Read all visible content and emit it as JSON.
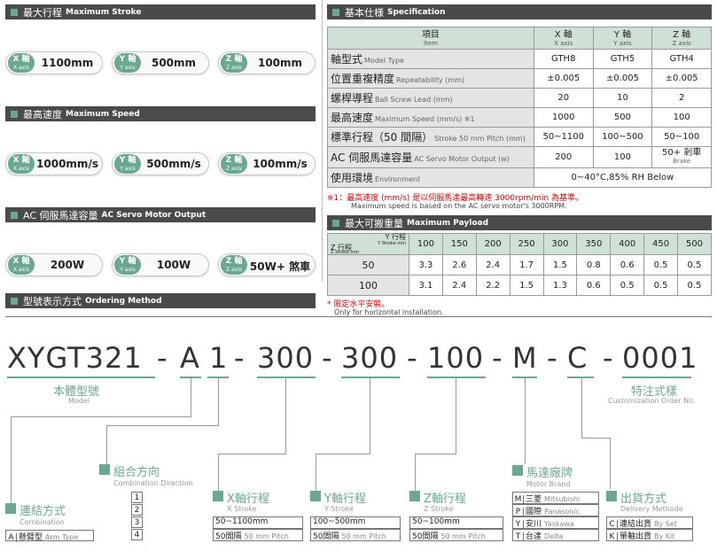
{
  "sections": {
    "stroke": {
      "zh": "最大行程",
      "en": "Maximum Stroke"
    },
    "speed": {
      "zh": "最高速度",
      "en": "Maximum Speed"
    },
    "motor": {
      "zh": "AC 伺服馬達容量",
      "en": "AC Servo Motor Output"
    },
    "spec": {
      "zh": "基本仕様",
      "en": "Specification"
    },
    "payload": {
      "zh": "最大可搬重量",
      "en": "Maximum Payload"
    },
    "ordering": {
      "zh": "型號表示方式",
      "en": "Ordering Method"
    }
  },
  "axis_labels": {
    "x": {
      "zh": "X 軸",
      "en": "X axis"
    },
    "y": {
      "zh": "Y 軸",
      "en": "Y axis"
    },
    "z": {
      "zh": "Z 軸",
      "en": "Z axis"
    }
  },
  "stroke_values": {
    "x": "1100mm",
    "y": "500mm",
    "z": "100mm"
  },
  "speed_values": {
    "x": "1000mm/s",
    "y": "500mm/s",
    "z": "100mm/s"
  },
  "motor_values": {
    "x": "200W",
    "y": "100W",
    "z": "50W+ 煞車"
  },
  "spec_table": {
    "header": {
      "item_zh": "項目",
      "item_en": "Item",
      "x_zh": "X 軸",
      "x_en": "X axis",
      "y_zh": "Y 軸",
      "y_en": "Y axis",
      "z_zh": "Z 軸",
      "z_en": "Z axis"
    },
    "rows": [
      {
        "zh": "軸型式",
        "en": "Model Type",
        "x": "GTH8",
        "y": "GTH5",
        "z": "GTH4"
      },
      {
        "zh": "位置重複精度",
        "en": "Repeatability (mm)",
        "x": "±0.005",
        "y": "±0.005",
        "z": "±0.005"
      },
      {
        "zh": "螺桿導程",
        "en": "Ball Screw Lead (mm)",
        "x": "20",
        "y": "10",
        "z": "2"
      },
      {
        "zh": "最高速度",
        "en": "Maximum Speed (mm/s) ※1",
        "x": "1000",
        "y": "500",
        "z": "100"
      },
      {
        "zh": "標準行程（50 間隔）",
        "en": "Stroke 50 mm Pitch (mm)",
        "x": "50~1100",
        "y": "100~500",
        "z": "50~100"
      },
      {
        "zh": "AC 伺服馬達容量",
        "en": "AC Servo Motor Output (w)",
        "x": "200",
        "y": "100",
        "z": "50+ 剎車",
        "z_sub": "Brake"
      },
      {
        "zh": "使用環境",
        "en": "Environment",
        "env": "0~40°C,85% RH Below"
      }
    ],
    "note_zh": "※1：最高速度 (mm/s) 是以伺服馬達最高轉速 3000rpm/min 為基準。",
    "note_en": "Maximum speed is based on the AC servo motor's 3000RPM."
  },
  "payload_table": {
    "corner_z": "Z 行程",
    "corner_z_en": "Z Stroke mm",
    "corner_y": "Y 行程",
    "corner_y_en": "Y Stroke mm",
    "cols": [
      "100",
      "150",
      "200",
      "250",
      "300",
      "350",
      "400",
      "450",
      "500"
    ],
    "rows": [
      {
        "label": "50",
        "vals": [
          "3.3",
          "2.6",
          "2.4",
          "1.7",
          "1.5",
          "0.8",
          "0.6",
          "0.5",
          "0.5"
        ]
      },
      {
        "label": "100",
        "vals": [
          "3.1",
          "2.4",
          "2.2",
          "1.5",
          "1.3",
          "0.6",
          "0.5",
          "0.5",
          "0.5"
        ]
      }
    ],
    "note_zh": "* 限定水平安裝。",
    "note_en": "Only for horizontal installation."
  },
  "ordering": {
    "code": [
      "XYGT321",
      "-",
      "A",
      "1",
      "-",
      "300",
      "-",
      "300",
      "-",
      "100",
      "-",
      "M",
      "-",
      "C",
      "-",
      "0001"
    ],
    "model": {
      "zh": "本體型號",
      "en": "Model"
    },
    "custom": {
      "zh": "特注式樣",
      "en": "Customization Order No."
    },
    "combination": {
      "zh": "連結方式",
      "en": "Combination",
      "opt_k": "A",
      "opt_v": "懸臂型",
      "opt_e": "Arm Type"
    },
    "direction": {
      "zh": "組合方向",
      "en": "Combination Direction",
      "opts": [
        "1",
        "2",
        "3",
        "4"
      ]
    },
    "x_stroke": {
      "zh": "X軸行程",
      "en": "X Stroke",
      "r1": "50~1100mm",
      "r2": "50間隔",
      "r2e": "50 mm Pitch"
    },
    "y_stroke": {
      "zh": "Y軸行程",
      "en": "Y Stroke",
      "r1": "100~500mm",
      "r2": "50間隔",
      "r2e": "50 mm Pitch"
    },
    "z_stroke": {
      "zh": "Z軸行程",
      "en": "Z Stroke",
      "r1": "50~100mm",
      "r2": "50間隔",
      "r2e": "50 mm Pitch"
    },
    "brand": {
      "zh": "馬達廠牌",
      "en": "Motor Brand",
      "opts": [
        {
          "k": "M",
          "v": "三菱",
          "e": "Mitsubishi"
        },
        {
          "k": "P",
          "v": "國際",
          "e": "Panasonic"
        },
        {
          "k": "Y",
          "v": "安川",
          "e": "Yaskawa"
        },
        {
          "k": "T",
          "v": "台達",
          "e": "Delta"
        }
      ]
    },
    "delivery": {
      "zh": "出貨方式",
      "en": "Delivery Methode",
      "opts": [
        {
          "k": "C",
          "v": "連結出貨",
          "e": "By Set"
        },
        {
          "k": "K",
          "v": "單軸出貨",
          "e": "By Kit"
        }
      ]
    }
  }
}
